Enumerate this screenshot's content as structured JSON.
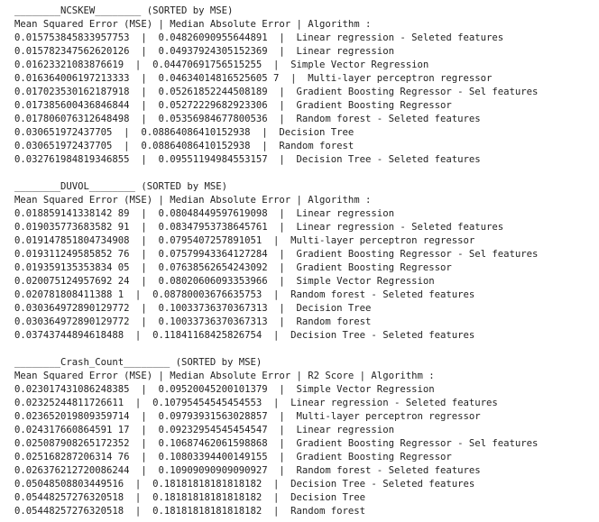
{
  "sections": [
    {
      "header": "________NCSKEW________ (SORTED by MSE)",
      "columns": "Mean Squared Error (MSE) | Median Absolute Error | Algorithm :",
      "rows": [
        "0.015753845833957753  |  0.04826090955644891  |  Linear regression - Seleted features",
        "0.015782347562620126  |  0.04937924305152369  |  Linear regression",
        "0.01623321083876619  |  0.04470691756515255  |  Simple Vector Regression",
        "0.016364006197213333  |  0.04634014816525605 7  |  Multi-layer perceptron regressor",
        "0.017023530162187918  |  0.05261852244508189  |  Gradient Boosting Regressor - Sel features",
        "0.017385600436846844  |  0.05272229682923306  |  Gradient Boosting Regressor",
        "0.017806076312648498  |  0.05356984677800536  |  Random forest - Seleted features",
        "0.030651972437705  |  0.08864086410152938  |  Decision Tree",
        "0.030651972437705  |  0.08864086410152938  |  Random forest",
        "0.032761984819346855  |  0.09551194984553157  |  Decision Tree - Seleted features"
      ]
    },
    {
      "header": "________DUVOL________ (SORTED by MSE)",
      "columns": "Mean Squared Error (MSE) | Median Absolute Error | Algorithm :",
      "rows": [
        "0.018859141338142 89  |  0.08048449597619098  |  Linear regression",
        "0.019035773683582 91  |  0.08347953738645761  |  Linear regression - Seleted features",
        "0.019147851804734908  |  0.0795407257891051  |  Multi-layer perceptron regressor",
        "0.019311249585852 76  |  0.07579943364127284  |  Gradient Boosting Regressor - Sel features",
        "0.019359135353834 05  |  0.07638562654243092  |  Gradient Boosting Regressor",
        "0.020075124957692 24  |  0.08020606093353966  |  Simple Vector Regression",
        "0.020781808411388 1  |  0.08780003676635753  |  Random forest - Seleted features",
        "0.030364972890129772  |  0.10033736370367313  |  Decision Tree",
        "0.030364972890129772  |  0.10033736370367313  |  Random forest",
        "0.03743744894618488  |  0.11841168425826754  |  Decision Tree - Seleted features"
      ]
    },
    {
      "header": "________Crash_Count________ (SORTED by MSE)",
      "columns": "Mean Squared Error (MSE) | Median Absolute Error | R2 Score | Algorithm :",
      "rows": [
        "0.023017431086248385  |  0.09520045200101379  |  Simple Vector Regression",
        "0.02325244811726611  |  0.10795454545454553  |  Linear regression - Seleted features",
        "0.023652019809359714  |  0.09793931563028857  |  Multi-layer perceptron regressor",
        "0.024317660864591 17  |  0.09232954545454547  |  Linear regression",
        "0.025087908265172352  |  0.10687462061598868  |  Gradient Boosting Regressor - Sel features",
        "0.025168287206314 76  |  0.10803394400149155  |  Gradient Boosting Regressor",
        "0.026376212720086244  |  0.10909090909090927  |  Random forest - Seleted features",
        "0.05048508803449516  |  0.18181818181818182  |  Decision Tree - Seleted features",
        "0.05448257276320518  |  0.18181818181818182  |  Decision Tree",
        "0.05448257276320518  |  0.18181818181818182  |  Random forest"
      ]
    }
  ]
}
